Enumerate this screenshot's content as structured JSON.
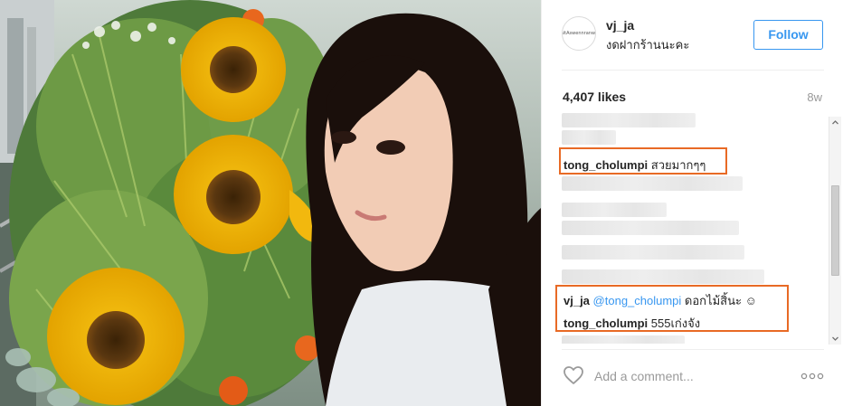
{
  "post": {
    "username": "vj_ja",
    "location": "งดฝากร้านนะคะ",
    "avatar_text": "sanitAswennranwork",
    "follow_label": "Follow",
    "likes": "4,407 likes",
    "time_ago": "8w"
  },
  "comments": {
    "highlight_1": {
      "user": "tong_cholumpi",
      "text": " สวยมากๆๆ"
    },
    "highlight_2": {
      "user": "vj_ja",
      "mention": "@tong_cholumpi",
      "text": " ดอกไม้สิ้นะ ☺"
    },
    "highlight_3": {
      "user": "tong_cholumpi",
      "text": " 555เก่งจัง"
    }
  },
  "compose": {
    "placeholder": "Add a comment..."
  },
  "icons": {
    "like": "heart-icon",
    "options": "more-options-icon",
    "photo_feature": "sunflower-bouquet"
  },
  "colors": {
    "accent": "#3897f0",
    "highlight": "#e86a25"
  }
}
